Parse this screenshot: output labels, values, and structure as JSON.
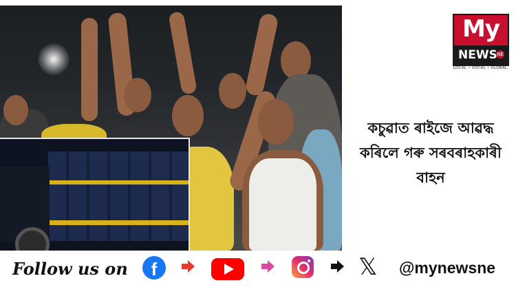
{
  "headline": {
    "line1": "কচুৱাত ৰাইজে আৱদ্ধ",
    "line2": "কৰিলে গৰু সৰবৰাহকাৰী",
    "line3": "বাহন"
  },
  "logo": {
    "my": "My",
    "news": "NEWS",
    "ne": "NE",
    "tagline_local": "LOCAL",
    "tagline_vocal": "VOCAL",
    "tagline_global": "GLOBAL",
    "brand_color": "#c8102e"
  },
  "footer": {
    "follow_text": "Follow us on",
    "handle": "@mynewsne",
    "icons": [
      "facebook-icon",
      "youtube-icon",
      "instagram-icon",
      "x-icon"
    ],
    "arrow_colors": [
      "#e63b2e",
      "#d94aa0",
      "#111111"
    ]
  },
  "photo": {
    "description_icon": "protest-photo",
    "inset_icon": "truck-inset-photo"
  }
}
